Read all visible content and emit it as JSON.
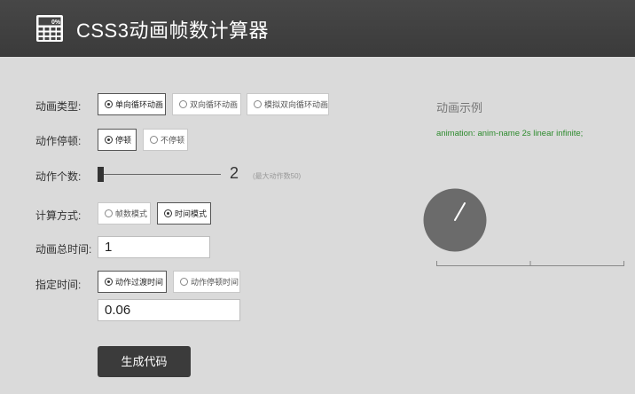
{
  "header": {
    "title": "CSS3动画帧数计算器",
    "logo_icon": "calculator-icon"
  },
  "form": {
    "anim_type": {
      "label": "动画类型:",
      "options": [
        "单向循环动画",
        "双向循环动画",
        "模拟双向循环动画"
      ],
      "selected": 0
    },
    "pause": {
      "label": "动作停顿:",
      "options": [
        "停顿",
        "不停顿"
      ],
      "selected": 0
    },
    "count": {
      "label": "动作个数:",
      "value": "2",
      "hint": "(最大动作数50)"
    },
    "calc_mode": {
      "label": "计算方式:",
      "options": [
        "帧数模式",
        "时间模式"
      ],
      "selected": 1
    },
    "total_time": {
      "label": "动画总时间:",
      "value": "1"
    },
    "specify_time": {
      "label": "指定时间:",
      "options": [
        "动作过渡时间",
        "动作停顿时间"
      ],
      "selected": 0,
      "value": "0.06"
    },
    "generate_label": "生成代码"
  },
  "demo": {
    "title": "动画示例",
    "code": "animation: anim-name 2s linear infinite;",
    "colors": {
      "circle": "#6b6b6b",
      "hand": "#ffffff",
      "code": "#2e8b2e"
    }
  }
}
